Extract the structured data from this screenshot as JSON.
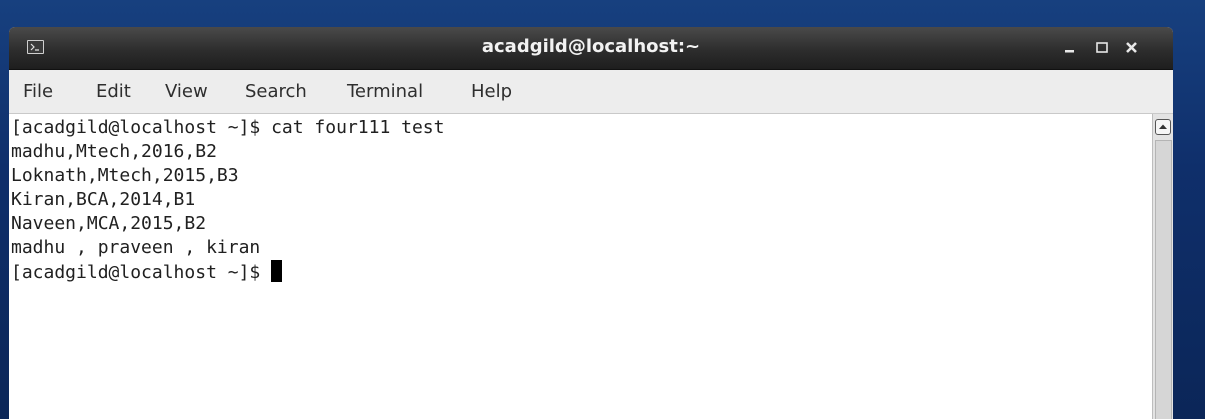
{
  "window": {
    "title": "acadgild@localhost:~",
    "icon": "terminal-icon",
    "controls": {
      "minimize": "_",
      "maximize": "□",
      "close": "×"
    }
  },
  "menu": {
    "items": [
      "File",
      "Edit",
      "View",
      "Search",
      "Terminal",
      "Help"
    ]
  },
  "terminal": {
    "lines": [
      "[acadgild@localhost ~]$ cat four111 test",
      "madhu,Mtech,2016,B2",
      "Loknath,Mtech,2015,B3",
      "Kiran,BCA,2014,B1",
      "Naveen,MCA,2015,B2",
      "madhu , praveen , kiran"
    ],
    "prompt": "[acadgild@localhost ~]$ "
  },
  "colors": {
    "titlebar": "#2d2d2d",
    "desktop": "#0f2f6b",
    "terminal_bg": "#ffffff",
    "terminal_fg": "#202020"
  }
}
